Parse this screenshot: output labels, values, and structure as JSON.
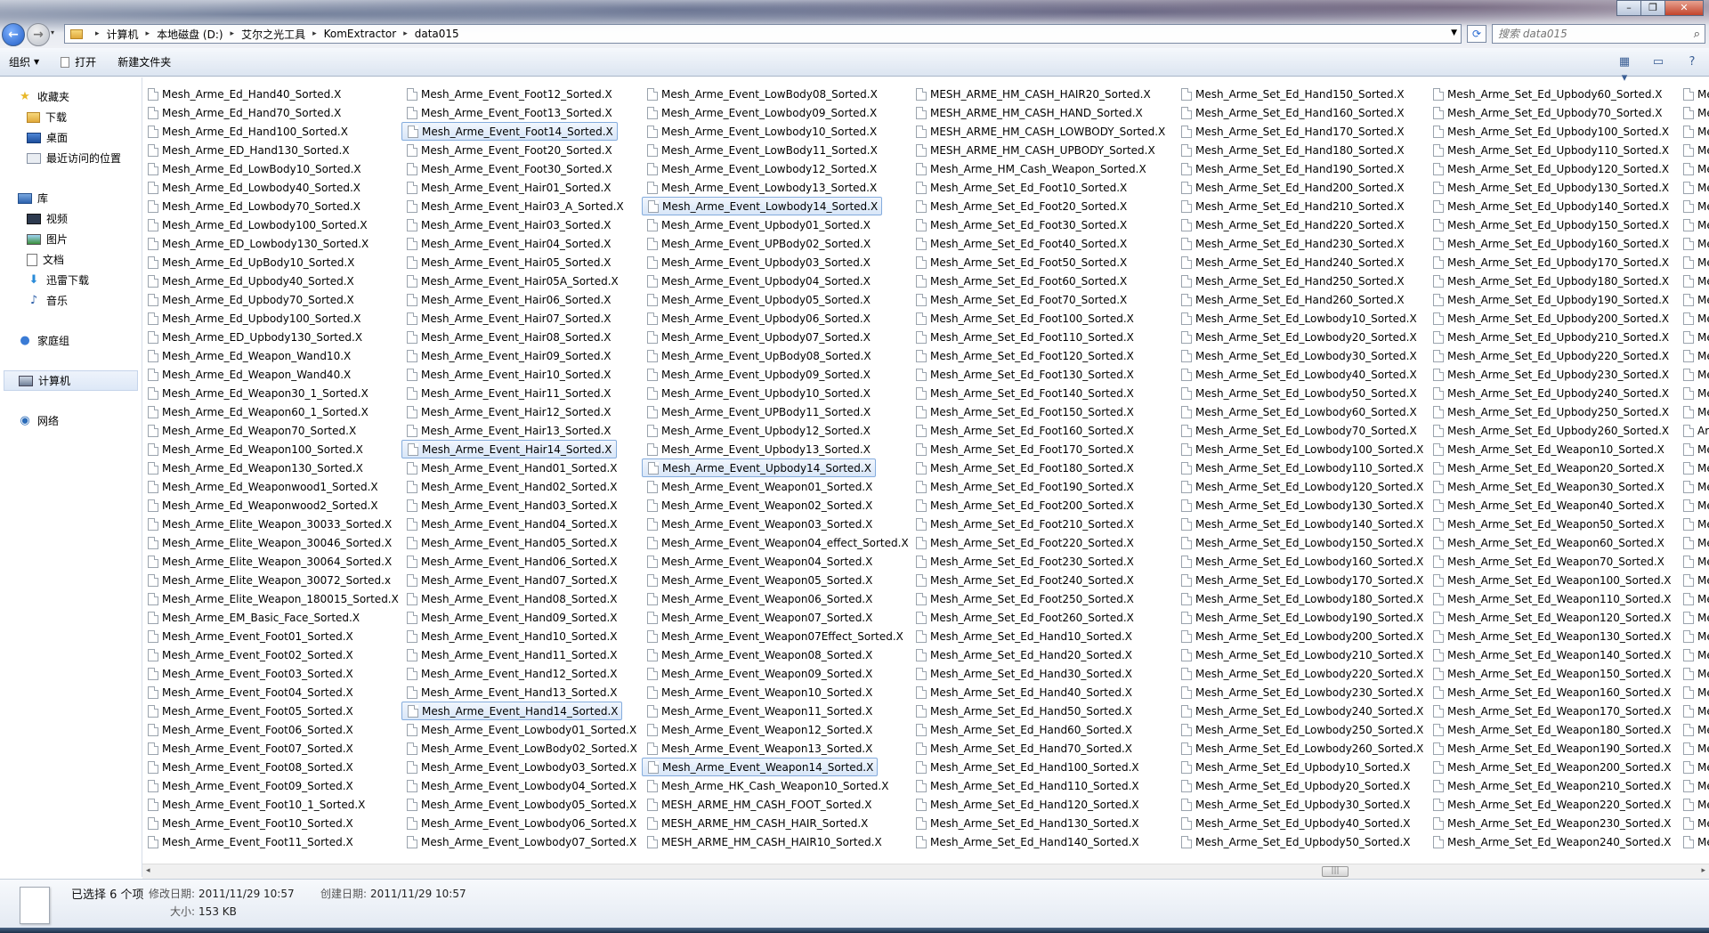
{
  "breadcrumb": [
    "计算机",
    "本地磁盘 (D:)",
    "艾尔之光工具",
    "KomExtractor",
    "data015"
  ],
  "search": {
    "placeholder": "搜索 data015"
  },
  "toolbar": {
    "organize": "组织",
    "open": "打开",
    "new_folder": "新建文件夹"
  },
  "sidebar": {
    "favorites": "收藏夹",
    "downloads": "下载",
    "desktop": "桌面",
    "recent": "最近访问的位置",
    "libraries": "库",
    "videos": "视频",
    "pictures": "图片",
    "documents": "文档",
    "xunlei": "迅雷下载",
    "music": "音乐",
    "homegroup": "家庭组",
    "computer": "计算机",
    "network": "网络"
  },
  "columns": [
    {
      "items": [
        "Mesh_Arme_Ed_Hand40_Sorted.X",
        "Mesh_Arme_Ed_Hand70_Sorted.X",
        "Mesh_Arme_Ed_Hand100_Sorted.X",
        "Mesh_Arme_ED_Hand130_Sorted.X",
        "Mesh_Arme_Ed_LowBody10_Sorted.X",
        "Mesh_Arme_Ed_Lowbody40_Sorted.X",
        "Mesh_Arme_Ed_Lowbody70_Sorted.X",
        "Mesh_Arme_Ed_Lowbody100_Sorted.X",
        "Mesh_Arme_ED_Lowbody130_Sorted.X",
        "Mesh_Arme_Ed_UpBody10_Sorted.X",
        "Mesh_Arme_Ed_Upbody40_Sorted.X",
        "Mesh_Arme_Ed_Upbody70_Sorted.X",
        "Mesh_Arme_Ed_Upbody100_Sorted.X",
        "Mesh_Arme_ED_Upbody130_Sorted.X",
        "Mesh_Arme_Ed_Weapon_Wand10.X",
        "Mesh_Arme_Ed_Weapon_Wand40.X",
        "Mesh_Arme_Ed_Weapon30_1_Sorted.X",
        "Mesh_Arme_Ed_Weapon60_1_Sorted.X",
        "Mesh_Arme_Ed_Weapon70_Sorted.X",
        "Mesh_Arme_Ed_Weapon100_Sorted.X",
        "Mesh_Arme_Ed_Weapon130_Sorted.X",
        "Mesh_Arme_Ed_Weaponwood1_Sorted.X",
        "Mesh_Arme_Ed_Weaponwood2_Sorted.X",
        "Mesh_Arme_Elite_Weapon_30033_Sorted.X",
        "Mesh_Arme_Elite_Weapon_30046_Sorted.X",
        "Mesh_Arme_Elite_Weapon_30064_Sorted.X",
        "Mesh_Arme_Elite_Weapon_30072_Sorted.x",
        "Mesh_Arme_Elite_Weapon_180015_Sorted.X",
        "Mesh_Arme_EM_Basic_Face_Sorted.X",
        "Mesh_Arme_Event_Foot01_Sorted.X",
        "Mesh_Arme_Event_Foot02_Sorted.X",
        "Mesh_Arme_Event_Foot03_Sorted.X",
        "Mesh_Arme_Event_Foot04_Sorted.X",
        "Mesh_Arme_Event_Foot05_Sorted.X",
        "Mesh_Arme_Event_Foot06_Sorted.X",
        "Mesh_Arme_Event_Foot07_Sorted.X",
        "Mesh_Arme_Event_Foot08_Sorted.X",
        "Mesh_Arme_Event_Foot09_Sorted.X",
        "Mesh_Arme_Event_Foot10_1_Sorted.X",
        "Mesh_Arme_Event_Foot10_Sorted.X",
        "Mesh_Arme_Event_Foot11_Sorted.X"
      ],
      "selected": []
    },
    {
      "items": [
        "Mesh_Arme_Event_Foot12_Sorted.X",
        "Mesh_Arme_Event_Foot13_Sorted.X",
        "Mesh_Arme_Event_Foot14_Sorted.X",
        "Mesh_Arme_Event_Foot20_Sorted.X",
        "Mesh_Arme_Event_Foot30_Sorted.X",
        "Mesh_Arme_Event_Hair01_Sorted.X",
        "Mesh_Arme_Event_Hair03_A_Sorted.X",
        "Mesh_Arme_Event_Hair03_Sorted.X",
        "Mesh_Arme_Event_Hair04_Sorted.X",
        "Mesh_Arme_Event_Hair05_Sorted.X",
        "Mesh_Arme_Event_Hair05A_Sorted.X",
        "Mesh_Arme_Event_Hair06_Sorted.X",
        "Mesh_Arme_Event_Hair07_Sorted.X",
        "Mesh_Arme_Event_Hair08_Sorted.X",
        "Mesh_Arme_Event_Hair09_Sorted.X",
        "Mesh_Arme_Event_Hair10_Sorted.X",
        "Mesh_Arme_Event_Hair11_Sorted.X",
        "Mesh_Arme_Event_Hair12_Sorted.X",
        "Mesh_Arme_Event_Hair13_Sorted.X",
        "Mesh_Arme_Event_Hair14_Sorted.X",
        "Mesh_Arme_Event_Hand01_Sorted.X",
        "Mesh_Arme_Event_Hand02_Sorted.X",
        "Mesh_Arme_Event_Hand03_Sorted.X",
        "Mesh_Arme_Event_Hand04_Sorted.X",
        "Mesh_Arme_Event_Hand05_Sorted.X",
        "Mesh_Arme_Event_Hand06_Sorted.X",
        "Mesh_Arme_Event_Hand07_Sorted.X",
        "Mesh_Arme_Event_Hand08_Sorted.X",
        "Mesh_Arme_Event_Hand09_Sorted.X",
        "Mesh_Arme_Event_Hand10_Sorted.X",
        "Mesh_Arme_Event_Hand11_Sorted.X",
        "Mesh_Arme_Event_Hand12_Sorted.X",
        "Mesh_Arme_Event_Hand13_Sorted.X",
        "Mesh_Arme_Event_Hand14_Sorted.X",
        "Mesh_Arme_Event_Lowbody01_Sorted.X",
        "Mesh_Arme_Event_LowBody02_Sorted.X",
        "Mesh_Arme_Event_Lowbody03_Sorted.X",
        "Mesh_Arme_Event_Lowbody04_Sorted.X",
        "Mesh_Arme_Event_Lowbody05_Sorted.X",
        "Mesh_Arme_Event_Lowbody06_Sorted.X",
        "Mesh_Arme_Event_Lowbody07_Sorted.X"
      ],
      "selected": [
        2,
        19,
        33
      ]
    },
    {
      "items": [
        "Mesh_Arme_Event_LowBody08_Sorted.X",
        "Mesh_Arme_Event_Lowbody09_Sorted.X",
        "Mesh_Arme_Event_Lowbody10_Sorted.X",
        "Mesh_Arme_Event_LowBody11_Sorted.X",
        "Mesh_Arme_Event_Lowbody12_Sorted.X",
        "Mesh_Arme_Event_Lowbody13_Sorted.X",
        "Mesh_Arme_Event_Lowbody14_Sorted.X",
        "Mesh_Arme_Event_Upbody01_Sorted.X",
        "Mesh_Arme_Event_UPBody02_Sorted.X",
        "Mesh_Arme_Event_Upbody03_Sorted.X",
        "Mesh_Arme_Event_Upbody04_Sorted.X",
        "Mesh_Arme_Event_Upbody05_Sorted.X",
        "Mesh_Arme_Event_Upbody06_Sorted.X",
        "Mesh_Arme_Event_Upbody07_Sorted.X",
        "Mesh_Arme_Event_UpBody08_Sorted.X",
        "Mesh_Arme_Event_Upbody09_Sorted.X",
        "Mesh_Arme_Event_Upbody10_Sorted.X",
        "Mesh_Arme_Event_UPBody11_Sorted.X",
        "Mesh_Arme_Event_Upbody12_Sorted.X",
        "Mesh_Arme_Event_Upbody13_Sorted.X",
        "Mesh_Arme_Event_Upbody14_Sorted.X",
        "Mesh_Arme_Event_Weapon01_Sorted.X",
        "Mesh_Arme_Event_Weapon02_Sorted.X",
        "Mesh_Arme_Event_Weapon03_Sorted.X",
        "Mesh_Arme_Event_Weapon04_effect_Sorted.X",
        "Mesh_Arme_Event_Weapon04_Sorted.X",
        "Mesh_Arme_Event_Weapon05_Sorted.X",
        "Mesh_Arme_Event_Weapon06_Sorted.X",
        "Mesh_Arme_Event_Weapon07_Sorted.X",
        "Mesh_Arme_Event_Weapon07Effect_Sorted.X",
        "Mesh_Arme_Event_Weapon08_Sorted.X",
        "Mesh_Arme_Event_Weapon09_Sorted.X",
        "Mesh_Arme_Event_Weapon10_Sorted.X",
        "Mesh_Arme_Event_Weapon11_Sorted.X",
        "Mesh_Arme_Event_Weapon12_Sorted.X",
        "Mesh_Arme_Event_Weapon13_Sorted.X",
        "Mesh_Arme_Event_Weapon14_Sorted.X",
        "Mesh_Arme_HK_Cash_Weapon10_Sorted.X",
        "MESH_ARME_HM_CASH_FOOT_Sorted.X",
        "MESH_ARME_HM_CASH_HAIR_Sorted.X",
        "MESH_ARME_HM_CASH_HAIR10_Sorted.X"
      ],
      "selected": [
        6,
        20,
        36
      ]
    },
    {
      "items": [
        "MESH_ARME_HM_CASH_HAIR20_Sorted.X",
        "MESH_ARME_HM_CASH_HAND_Sorted.X",
        "MESH_ARME_HM_CASH_LOWBODY_Sorted.X",
        "MESH_ARME_HM_CASH_UPBODY_Sorted.X",
        "Mesh_Arme_HM_Cash_Weapon_Sorted.X",
        "Mesh_Arme_Set_Ed_Foot10_Sorted.X",
        "Mesh_Arme_Set_Ed_Foot20_Sorted.X",
        "Mesh_Arme_Set_Ed_Foot30_Sorted.X",
        "Mesh_Arme_Set_Ed_Foot40_Sorted.X",
        "Mesh_Arme_Set_Ed_Foot50_Sorted.X",
        "Mesh_Arme_Set_Ed_Foot60_Sorted.X",
        "Mesh_Arme_Set_Ed_Foot70_Sorted.X",
        "Mesh_Arme_Set_Ed_Foot100_Sorted.X",
        "Mesh_Arme_Set_Ed_Foot110_Sorted.X",
        "Mesh_Arme_Set_Ed_Foot120_Sorted.X",
        "Mesh_Arme_Set_Ed_Foot130_Sorted.X",
        "Mesh_Arme_Set_Ed_Foot140_Sorted.X",
        "Mesh_Arme_Set_Ed_Foot150_Sorted.X",
        "Mesh_Arme_Set_Ed_Foot160_Sorted.X",
        "Mesh_Arme_Set_Ed_Foot170_Sorted.X",
        "Mesh_Arme_Set_Ed_Foot180_Sorted.X",
        "Mesh_Arme_Set_Ed_Foot190_Sorted.X",
        "Mesh_Arme_Set_Ed_Foot200_Sorted.X",
        "Mesh_Arme_Set_Ed_Foot210_Sorted.X",
        "Mesh_Arme_Set_Ed_Foot220_Sorted.X",
        "Mesh_Arme_Set_Ed_Foot230_Sorted.X",
        "Mesh_Arme_Set_Ed_Foot240_Sorted.X",
        "Mesh_Arme_Set_Ed_Foot250_Sorted.X",
        "Mesh_Arme_Set_Ed_Foot260_Sorted.X",
        "Mesh_Arme_Set_Ed_Hand10_Sorted.X",
        "Mesh_Arme_Set_Ed_Hand20_Sorted.X",
        "Mesh_Arme_Set_Ed_Hand30_Sorted.X",
        "Mesh_Arme_Set_Ed_Hand40_Sorted.X",
        "Mesh_Arme_Set_Ed_Hand50_Sorted.X",
        "Mesh_Arme_Set_Ed_Hand60_Sorted.X",
        "Mesh_Arme_Set_Ed_Hand70_Sorted.X",
        "Mesh_Arme_Set_Ed_Hand100_Sorted.X",
        "Mesh_Arme_Set_Ed_Hand110_Sorted.X",
        "Mesh_Arme_Set_Ed_Hand120_Sorted.X",
        "Mesh_Arme_Set_Ed_Hand130_Sorted.X",
        "Mesh_Arme_Set_Ed_Hand140_Sorted.X"
      ],
      "selected": []
    },
    {
      "items": [
        "Mesh_Arme_Set_Ed_Hand150_Sorted.X",
        "Mesh_Arme_Set_Ed_Hand160_Sorted.X",
        "Mesh_Arme_Set_Ed_Hand170_Sorted.X",
        "Mesh_Arme_Set_Ed_Hand180_Sorted.X",
        "Mesh_Arme_Set_Ed_Hand190_Sorted.X",
        "Mesh_Arme_Set_Ed_Hand200_Sorted.X",
        "Mesh_Arme_Set_Ed_Hand210_Sorted.X",
        "Mesh_Arme_Set_Ed_Hand220_Sorted.X",
        "Mesh_Arme_Set_Ed_Hand230_Sorted.X",
        "Mesh_Arme_Set_Ed_Hand240_Sorted.X",
        "Mesh_Arme_Set_Ed_Hand250_Sorted.X",
        "Mesh_Arme_Set_Ed_Hand260_Sorted.X",
        "Mesh_Arme_Set_Ed_Lowbody10_Sorted.X",
        "Mesh_Arme_Set_Ed_Lowbody20_Sorted.X",
        "Mesh_Arme_Set_Ed_Lowbody30_Sorted.X",
        "Mesh_Arme_Set_Ed_Lowbody40_Sorted.X",
        "Mesh_Arme_Set_Ed_Lowbody50_Sorted.X",
        "Mesh_Arme_Set_Ed_Lowbody60_Sorted.X",
        "Mesh_Arme_Set_Ed_Lowbody70_Sorted.X",
        "Mesh_Arme_Set_Ed_Lowbody100_Sorted.X",
        "Mesh_Arme_Set_Ed_Lowbody110_Sorted.X",
        "Mesh_Arme_Set_Ed_Lowbody120_Sorted.X",
        "Mesh_Arme_Set_Ed_Lowbody130_Sorted.X",
        "Mesh_Arme_Set_Ed_Lowbody140_Sorted.X",
        "Mesh_Arme_Set_Ed_Lowbody150_Sorted.X",
        "Mesh_Arme_Set_Ed_Lowbody160_Sorted.X",
        "Mesh_Arme_Set_Ed_Lowbody170_Sorted.X",
        "Mesh_Arme_Set_Ed_Lowbody180_Sorted.X",
        "Mesh_Arme_Set_Ed_Lowbody190_Sorted.X",
        "Mesh_Arme_Set_Ed_Lowbody200_Sorted.X",
        "Mesh_Arme_Set_Ed_Lowbody210_Sorted.X",
        "Mesh_Arme_Set_Ed_Lowbody220_Sorted.X",
        "Mesh_Arme_Set_Ed_Lowbody230_Sorted.X",
        "Mesh_Arme_Set_Ed_Lowbody240_Sorted.X",
        "Mesh_Arme_Set_Ed_Lowbody250_Sorted.X",
        "Mesh_Arme_Set_Ed_Lowbody260_Sorted.X",
        "Mesh_Arme_Set_Ed_Upbody10_Sorted.X",
        "Mesh_Arme_Set_Ed_Upbody20_Sorted.X",
        "Mesh_Arme_Set_Ed_Upbody30_Sorted.X",
        "Mesh_Arme_Set_Ed_Upbody40_Sorted.X",
        "Mesh_Arme_Set_Ed_Upbody50_Sorted.X"
      ],
      "selected": []
    },
    {
      "items": [
        "Mesh_Arme_Set_Ed_Upbody60_Sorted.X",
        "Mesh_Arme_Set_Ed_Upbody70_Sorted.X",
        "Mesh_Arme_Set_Ed_Upbody100_Sorted.X",
        "Mesh_Arme_Set_Ed_Upbody110_Sorted.X",
        "Mesh_Arme_Set_Ed_Upbody120_Sorted.X",
        "Mesh_Arme_Set_Ed_Upbody130_Sorted.X",
        "Mesh_Arme_Set_Ed_Upbody140_Sorted.X",
        "Mesh_Arme_Set_Ed_Upbody150_Sorted.X",
        "Mesh_Arme_Set_Ed_Upbody160_Sorted.X",
        "Mesh_Arme_Set_Ed_Upbody170_Sorted.X",
        "Mesh_Arme_Set_Ed_Upbody180_Sorted.X",
        "Mesh_Arme_Set_Ed_Upbody190_Sorted.X",
        "Mesh_Arme_Set_Ed_Upbody200_Sorted.X",
        "Mesh_Arme_Set_Ed_Upbody210_Sorted.X",
        "Mesh_Arme_Set_Ed_Upbody220_Sorted.X",
        "Mesh_Arme_Set_Ed_Upbody230_Sorted.X",
        "Mesh_Arme_Set_Ed_Upbody240_Sorted.X",
        "Mesh_Arme_Set_Ed_Upbody250_Sorted.X",
        "Mesh_Arme_Set_Ed_Upbody260_Sorted.X",
        "Mesh_Arme_Set_Ed_Weapon10_Sorted.X",
        "Mesh_Arme_Set_Ed_Weapon20_Sorted.X",
        "Mesh_Arme_Set_Ed_Weapon30_Sorted.X",
        "Mesh_Arme_Set_Ed_Weapon40_Sorted.X",
        "Mesh_Arme_Set_Ed_Weapon50_Sorted.X",
        "Mesh_Arme_Set_Ed_Weapon60_Sorted.X",
        "Mesh_Arme_Set_Ed_Weapon70_Sorted.X",
        "Mesh_Arme_Set_Ed_Weapon100_Sorted.X",
        "Mesh_Arme_Set_Ed_Weapon110_Sorted.X",
        "Mesh_Arme_Set_Ed_Weapon120_Sorted.X",
        "Mesh_Arme_Set_Ed_Weapon130_Sorted.X",
        "Mesh_Arme_Set_Ed_Weapon140_Sorted.X",
        "Mesh_Arme_Set_Ed_Weapon150_Sorted.X",
        "Mesh_Arme_Set_Ed_Weapon160_Sorted.X",
        "Mesh_Arme_Set_Ed_Weapon170_Sorted.X",
        "Mesh_Arme_Set_Ed_Weapon180_Sorted.X",
        "Mesh_Arme_Set_Ed_Weapon190_Sorted.X",
        "Mesh_Arme_Set_Ed_Weapon200_Sorted.X",
        "Mesh_Arme_Set_Ed_Weapon210_Sorted.X",
        "Mesh_Arme_Set_Ed_Weapon220_Sorted.X",
        "Mesh_Arme_Set_Ed_Weapon230_Sorted.X",
        "Mesh_Arme_Set_Ed_Weapon240_Sorted.X"
      ],
      "selected": []
    },
    {
      "items": [
        "Me",
        "Me",
        "Me",
        "Me",
        "Me",
        "Me",
        "Me",
        "Me",
        "Me",
        "Me",
        "Me",
        "Me",
        "Me",
        "Me",
        "Me",
        "Me",
        "Me",
        "Me",
        "Ar",
        "Me",
        "Me",
        "Me",
        "Me",
        "Me",
        "Me",
        "Me",
        "Me",
        "Me",
        "Me",
        "Me",
        "Me",
        "Me",
        "Me",
        "Me",
        "Me",
        "Me",
        "Me",
        "Me",
        "Me",
        "Me",
        "Me"
      ],
      "selected": []
    }
  ],
  "details": {
    "selected_count": "已选择 6 个项",
    "modified_label": "修改日期:",
    "modified_value": "2011/11/29 10:57",
    "created_label": "创建日期:",
    "created_value": "2011/11/29 10:57",
    "size_label": "大小:",
    "size_value": "153 KB"
  }
}
